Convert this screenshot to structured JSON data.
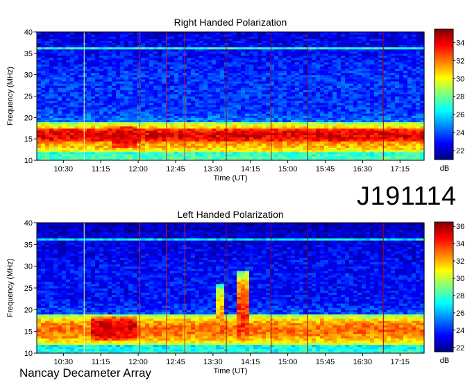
{
  "identifier": "J191114",
  "footer": "Nancay Decameter Array",
  "colormap": [
    "#00007f",
    "#0000ff",
    "#007fff",
    "#00ffff",
    "#7fff7f",
    "#ffff00",
    "#ff7f00",
    "#ff0000",
    "#7f0000"
  ],
  "chart_data": [
    {
      "type": "heatmap",
      "title": "Right Handed Polarization",
      "xlabel": "Time (UT)",
      "ylabel": "Frequency (MHz)",
      "x_ticks": [
        "10:30",
        "11:15",
        "12:00",
        "12:45",
        "13:30",
        "14:15",
        "15:00",
        "15:45",
        "16:30",
        "17:15"
      ],
      "x_tick_minutes": [
        630,
        675,
        720,
        765,
        810,
        855,
        900,
        945,
        990,
        1035
      ],
      "xlim_minutes": [
        598,
        1064
      ],
      "y_ticks": [
        10,
        15,
        20,
        25,
        30,
        35,
        40
      ],
      "ylim": [
        10,
        40
      ],
      "colorbar": {
        "label": "dB",
        "ticks": [
          22,
          24,
          26,
          28,
          30,
          32,
          34
        ],
        "range": [
          21,
          35.5
        ]
      },
      "vertical_markers": [
        {
          "t": 655,
          "color": "#ffffaa"
        },
        {
          "t": 722,
          "color": "#cc2222"
        },
        {
          "t": 754,
          "color": "#cc2222"
        },
        {
          "t": 776,
          "color": "#cc2222"
        },
        {
          "t": 826,
          "color": "#990000"
        },
        {
          "t": 880,
          "color": "#aa0000"
        },
        {
          "t": 924,
          "color": "#990000"
        },
        {
          "t": 1015,
          "color": "#aa0000"
        }
      ],
      "features": [
        {
          "kind": "band",
          "f_low": 12,
          "f_high": 19,
          "level": 32
        },
        {
          "kind": "band",
          "f_low": 14.5,
          "f_high": 17.5,
          "level": 34
        },
        {
          "kind": "burst",
          "t_start": 688,
          "t_end": 716,
          "f_low": 13,
          "f_high": 18,
          "level": 34
        },
        {
          "kind": "band",
          "f_low": 35.8,
          "f_high": 36.6,
          "level": 27
        }
      ]
    },
    {
      "type": "heatmap",
      "title": "Left Handed Polarization",
      "xlabel": "Time (UT)",
      "ylabel": "Frequency (MHz)",
      "x_ticks": [
        "10:30",
        "11:15",
        "12:00",
        "12:45",
        "13:30",
        "14:15",
        "15:00",
        "15:45",
        "16:30",
        "17:15"
      ],
      "x_tick_minutes": [
        630,
        675,
        720,
        765,
        810,
        855,
        900,
        945,
        990,
        1035
      ],
      "xlim_minutes": [
        598,
        1064
      ],
      "y_ticks": [
        10,
        15,
        20,
        25,
        30,
        35,
        40
      ],
      "ylim": [
        10,
        40
      ],
      "colorbar": {
        "label": "dB",
        "ticks": [
          22,
          24,
          26,
          28,
          30,
          32,
          34,
          36
        ],
        "range": [
          21.5,
          36.5
        ]
      },
      "vertical_markers": [
        {
          "t": 655,
          "color": "#ffffaa"
        },
        {
          "t": 722,
          "color": "#cc2222"
        },
        {
          "t": 754,
          "color": "#cc2222"
        },
        {
          "t": 776,
          "color": "#cc2222"
        },
        {
          "t": 826,
          "color": "#990000"
        },
        {
          "t": 880,
          "color": "#aa0000"
        },
        {
          "t": 924,
          "color": "#990000"
        },
        {
          "t": 1015,
          "color": "#aa0000"
        }
      ],
      "features": [
        {
          "kind": "band",
          "f_low": 12,
          "f_high": 19,
          "level": 33
        },
        {
          "kind": "burst",
          "t_start": 665,
          "t_end": 720,
          "f_low": 13,
          "f_high": 18.5,
          "level": 35
        },
        {
          "kind": "burst",
          "t_start": 813,
          "t_end": 823,
          "f_low": 13,
          "f_high": 26,
          "level": 32
        },
        {
          "kind": "burst",
          "t_start": 839,
          "t_end": 853,
          "f_low": 13,
          "f_high": 29,
          "level": 34
        },
        {
          "kind": "band",
          "f_low": 35.8,
          "f_high": 36.6,
          "level": 27
        }
      ]
    }
  ]
}
